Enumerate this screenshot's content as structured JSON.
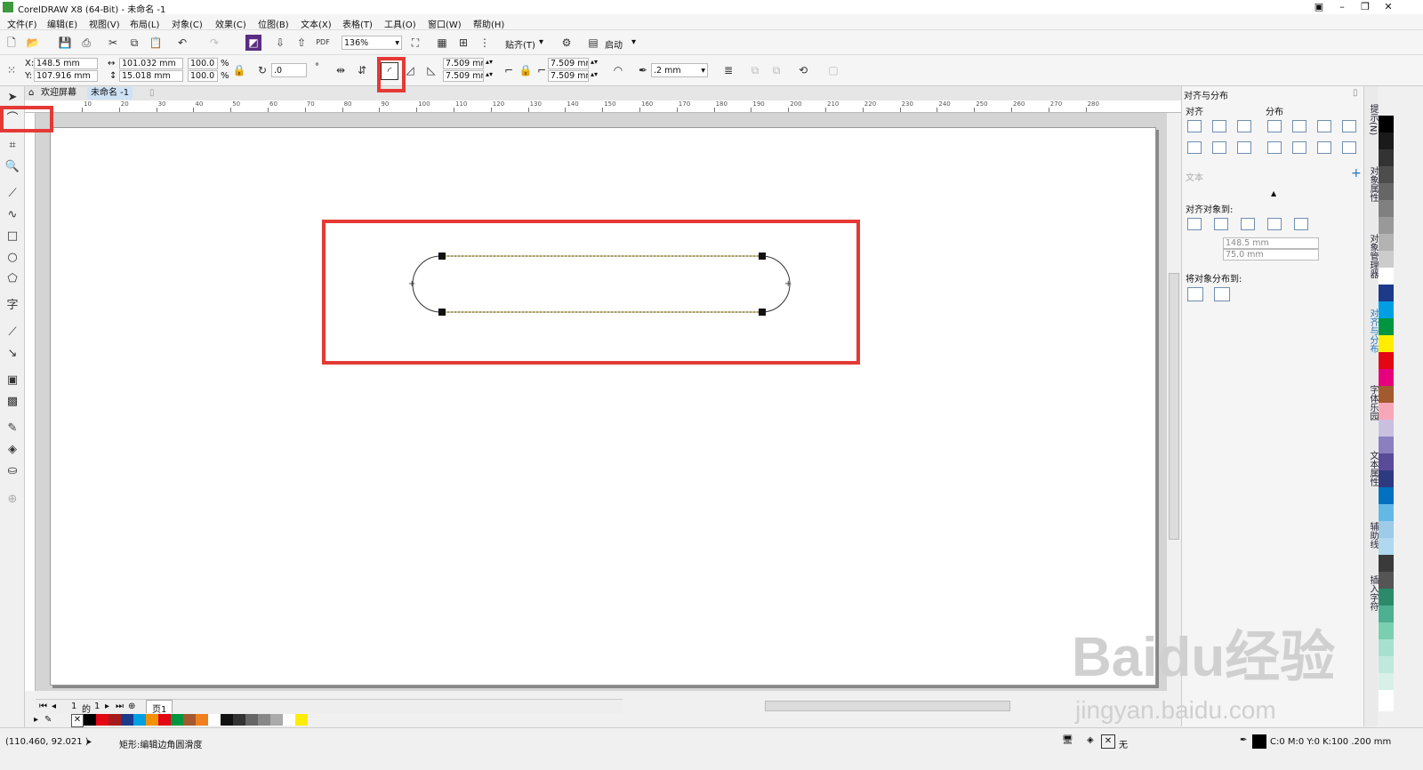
{
  "window": {
    "title": "CorelDRAW X8 (64-Bit) - 未命名 -1"
  },
  "menu": [
    "文件(F)",
    "编辑(E)",
    "视图(V)",
    "布局(L)",
    "对象(C)",
    "效果(C)",
    "位图(B)",
    "文本(X)",
    "表格(T)",
    "工具(O)",
    "窗口(W)",
    "帮助(H)"
  ],
  "toolbar1": {
    "zoom": "136%",
    "snap_label": "贴齐(T)",
    "launch_label": "启动"
  },
  "toolbar2": {
    "x_label": "X:",
    "x": "148.5 mm",
    "y_label": "Y:",
    "y": "107.916 mm",
    "width": "101.032 mm",
    "height": "15.018 mm",
    "scale_w": "100.0",
    "scale_h": "100.0",
    "percent": "%",
    "rotation": ".0",
    "degree": "°",
    "corner_tl": "7.509 mm",
    "corner_bl": "7.509 mm",
    "corner_tr": "7.509 mm",
    "corner_br": "7.509 mm",
    "outline_width": ".2 mm"
  },
  "doc_tabs": {
    "welcome": "欢迎屏幕",
    "document": "未命名 -1"
  },
  "ruler_labels": [
    "10",
    "20",
    "30",
    "40",
    "50",
    "60",
    "70",
    "80",
    "90",
    "100",
    "110",
    "120",
    "130",
    "140",
    "150",
    "160",
    "170",
    "180",
    "190",
    "200",
    "210",
    "220",
    "230",
    "240",
    "250",
    "260",
    "270",
    "280"
  ],
  "page_nav": {
    "current": "1",
    "of": "的",
    "total": "1",
    "page_tab": "页1"
  },
  "docker": {
    "title": "对齐与分布",
    "align_label": "对齐",
    "distribute_label": "分布",
    "text_label": "文本",
    "align_to_label": "对齐对象到:",
    "x_value": "148.5 mm",
    "y_value": "75.0 mm",
    "distribute_to_label": "将对象分布到:"
  },
  "docker_tabs": [
    "提示(N)",
    "对象属性",
    "对象管理器",
    "对齐与分布",
    "字体乐园",
    "文本属性",
    "辅助线",
    "插入字符"
  ],
  "status": {
    "coords": "(110.460, 92.021 )",
    "message": "矩形:编辑边角圆滑度",
    "fill_label": "无",
    "outline_info": "C:0 M:0 Y:0 K:100 .200 mm"
  },
  "bottom_palette": [
    "#000000",
    "#e30613",
    "#a51b1b",
    "#1d3a8a",
    "#009fe3",
    "#f39200",
    "#e30613",
    "#009640",
    "#a35a2e",
    "#f07f1e",
    "#ffffff",
    "#111111",
    "#333333",
    "#666666",
    "#888888",
    "#aaaaaa",
    "#ffffff",
    "#ffed00"
  ],
  "side_palette": [
    "#000000",
    "#1a1a1a",
    "#333333",
    "#4d4d4d",
    "#666666",
    "#808080",
    "#999999",
    "#b3b3b3",
    "#cccccc",
    "#ffffff",
    "#1d3a8a",
    "#009fe3",
    "#009640",
    "#ffed00",
    "#e30613",
    "#e6007e",
    "#a35a2e",
    "#f7a8b8",
    "#c9c0e0",
    "#8b7fc0",
    "#5a4a9a",
    "#2e3a80",
    "#0070c0",
    "#63b8e6",
    "#9ecbe8",
    "#b0d8f0",
    "#3a3a3a",
    "#555555",
    "#2a8a6a",
    "#4db090",
    "#7acfb0",
    "#a8e0d0",
    "#c0e8dc",
    "#d8f0e8"
  ],
  "watermark": {
    "main": "Baidu经验",
    "sub": "jingyan.baidu.com"
  }
}
